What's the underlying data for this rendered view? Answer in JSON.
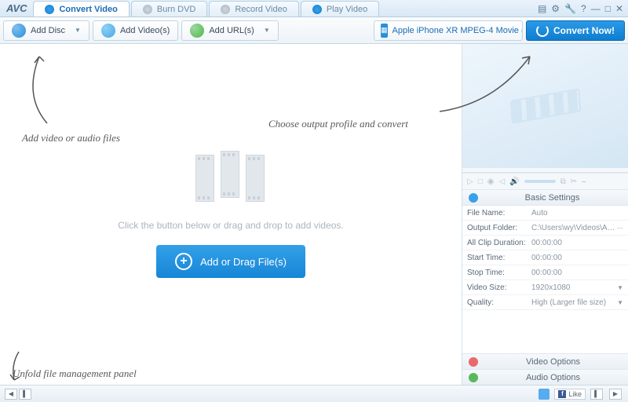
{
  "app": {
    "logo": "AVC"
  },
  "tabs": [
    {
      "label": "Convert Video",
      "active": true
    },
    {
      "label": "Burn DVD",
      "active": false
    },
    {
      "label": "Record Video",
      "active": false
    },
    {
      "label": "Play Video",
      "active": false
    }
  ],
  "toolbar": {
    "add_disc": "Add Disc",
    "add_videos": "Add Video(s)",
    "add_urls": "Add URL(s)",
    "profile": "Apple iPhone XR MPEG-4 Movie (*.m...",
    "convert_now": "Convert Now!"
  },
  "center": {
    "hint": "Click the button below or drag and drop to add videos.",
    "add_button": "Add or Drag File(s)"
  },
  "settings": {
    "header": "Basic Settings",
    "rows": [
      {
        "label": "File Name:",
        "value": "Auto",
        "dropdown": false
      },
      {
        "label": "Output Folder:",
        "value": "C:\\Users\\wy\\Videos\\An...",
        "dropdown": false,
        "browse": true
      },
      {
        "label": "All Clip Duration:",
        "value": "00:00:00",
        "dropdown": false
      },
      {
        "label": "Start Time:",
        "value": "00:00:00",
        "dropdown": false
      },
      {
        "label": "Stop Time:",
        "value": "00:00:00",
        "dropdown": false
      },
      {
        "label": "Video Size:",
        "value": "1920x1080",
        "dropdown": true
      },
      {
        "label": "Quality:",
        "value": "High (Larger file size)",
        "dropdown": true
      }
    ],
    "video_options": "Video Options",
    "audio_options": "Audio Options"
  },
  "status": {
    "like": "Like"
  },
  "annotations": {
    "add_files": "Add video or audio files",
    "choose_profile": "Choose output profile and convert",
    "unfold": "Unfold file management panel"
  }
}
